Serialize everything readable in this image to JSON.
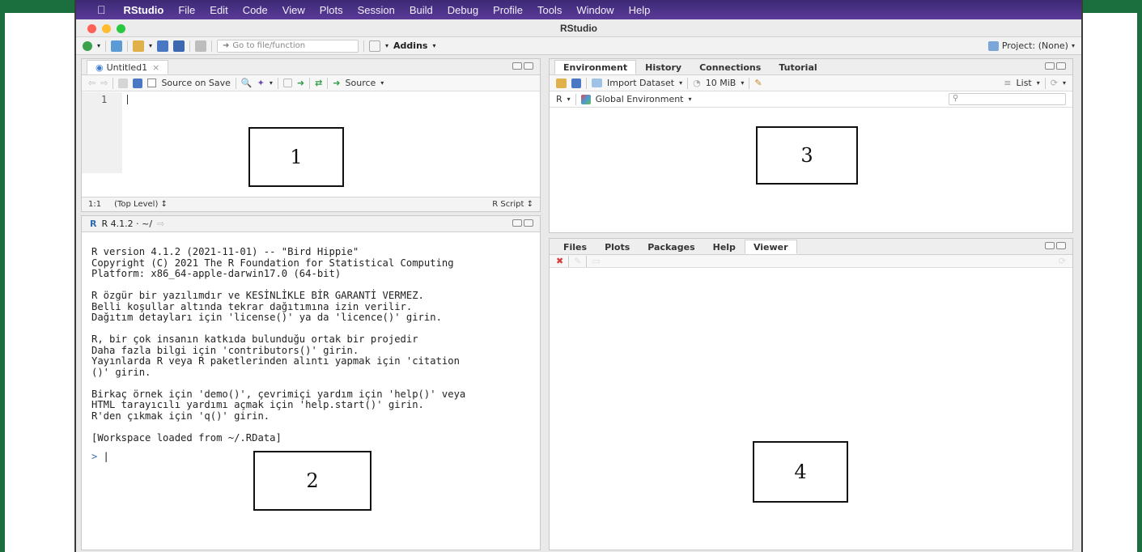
{
  "menubar": {
    "app_name": "RStudio",
    "items": [
      "File",
      "Edit",
      "Code",
      "View",
      "Plots",
      "Session",
      "Build",
      "Debug",
      "Profile",
      "Tools",
      "Window",
      "Help"
    ]
  },
  "window_title": "RStudio",
  "toolbar": {
    "goto_placeholder": "Go to file/function",
    "addins_label": "Addins",
    "project_label": "Project: (None)"
  },
  "source_pane": {
    "tab_label": "Untitled1",
    "source_on_save_label": "Source on Save",
    "source_label": "Source",
    "line_number": "1",
    "status_position": "1:1",
    "status_scope": "(Top Level) ↕",
    "status_type": "R Script ↕",
    "annotation_number": "1"
  },
  "console_pane": {
    "header_label": "R 4.1.2 · ~/",
    "lines": [
      "R version 4.1.2 (2021-11-01) -- \"Bird Hippie\"",
      "Copyright (C) 2021 The R Foundation for Statistical Computing",
      "Platform: x86_64-apple-darwin17.0 (64-bit)",
      "",
      "R özgür bir yazılımdır ve KESİNLİKLE BİR GARANTİ VERMEZ.",
      "Belli koşullar altında tekrar dağıtımına izin verilir.",
      "Dağıtım detayları için 'license()' ya da 'licence()' girin.",
      "",
      "R, bir çok insanın katkıda bulunduğu ortak bir projedir",
      "Daha fazla bilgi için 'contributors()' girin.",
      "Yayınlarda R veya R paketlerinden alıntı yapmak için 'citation",
      "()' girin.",
      "",
      "Birkaç örnek için 'demo()', çevrimiçi yardım için 'help()' veya",
      "HTML tarayıcılı yardımı açmak için 'help.start()' girin.",
      "R'den çıkmak için 'q()' girin.",
      "",
      "[Workspace loaded from ~/.RData]"
    ],
    "prompt": ">",
    "annotation_number": "2"
  },
  "environment_pane": {
    "tabs": [
      "Environment",
      "History",
      "Connections",
      "Tutorial"
    ],
    "import_dataset_label": "Import Dataset",
    "memory_label": "10 MiB",
    "list_label": "List",
    "language_label": "R",
    "scope_label": "Global Environment",
    "annotation_number": "3"
  },
  "files_pane": {
    "tabs": [
      "Files",
      "Plots",
      "Packages",
      "Help",
      "Viewer"
    ],
    "annotation_number": "4"
  },
  "colors": {
    "frame_green": "#1b6f3e",
    "menubar_purple": "#4a3288"
  }
}
